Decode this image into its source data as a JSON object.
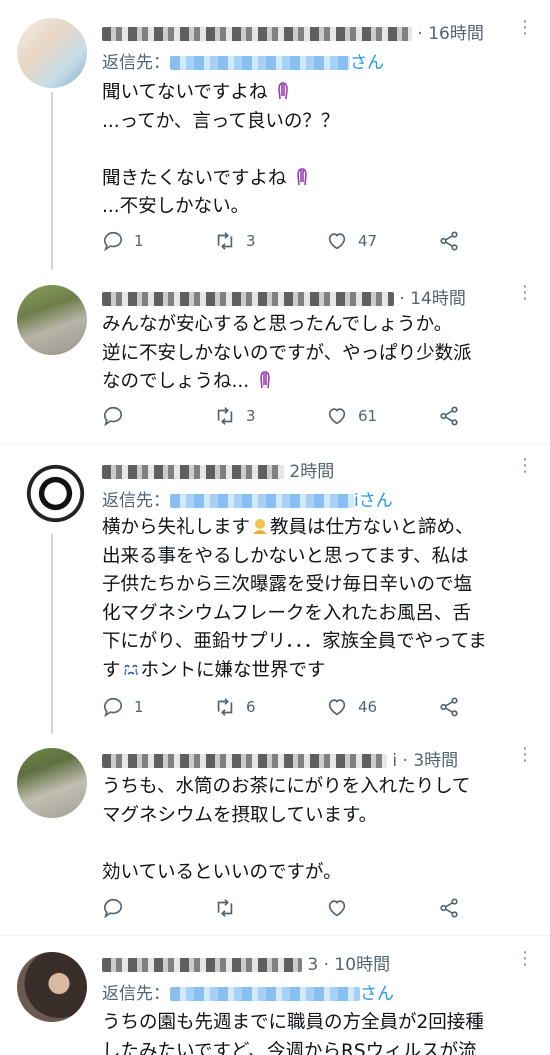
{
  "tweets": [
    {
      "time": "· 16時間",
      "reply_label": "返信先：",
      "reply_suffix": "さん",
      "lines": [
        "聞いてないですよね",
        "...ってか、言って良いの？？",
        "",
        "聞きたくないですよね",
        "...不安しかない。"
      ],
      "replies": "1",
      "retweets": "3",
      "likes": "47"
    },
    {
      "time": "· 14時間",
      "lines": [
        "みんなが安心すると思ったんでしょうか。",
        "逆に不安しかないのですが、やっぱり少数派",
        "なのでしょうね..."
      ],
      "replies": "",
      "retweets": "3",
      "likes": "61"
    },
    {
      "time": "2時間",
      "reply_label": "返信先：",
      "reply_suffix": "iさん",
      "lines": [
        "横から失礼します",
        "教員は仕方ないと諦め、",
        "出来る事をやるしかないと思ってます、私は",
        "子供たちから三次曝露を受け毎日辛いので塩",
        "化マグネシウムフレークを入れたお風呂、舌",
        "下にがり、亜鉛サプリ．．．家族全員でやってま",
        "す",
        "ホントに嫌な世界です"
      ],
      "replies": "1",
      "retweets": "6",
      "likes": "46"
    },
    {
      "time": "i · 3時間",
      "lines": [
        "うちも、水筒のお茶ににがりを入れたりして",
        "マグネシウムを摂取しています。",
        "",
        "効いているといいのですが。"
      ],
      "replies": "",
      "retweets": "",
      "likes": ""
    },
    {
      "time": "3 · 10時間",
      "reply_label": "返信先：",
      "reply_suffix": "さん",
      "lines": [
        "うちの園も先週までに職員の方全員が2回接種",
        "したみたいですど、今週からRSウィルスが流"
      ]
    }
  ],
  "colors": {
    "link": "#1d9bf0",
    "muted": "#536471",
    "thread": "#cfd9de"
  },
  "icons": [
    "reply-icon",
    "retweet-icon",
    "like-icon",
    "share-icon",
    "more-icon"
  ]
}
